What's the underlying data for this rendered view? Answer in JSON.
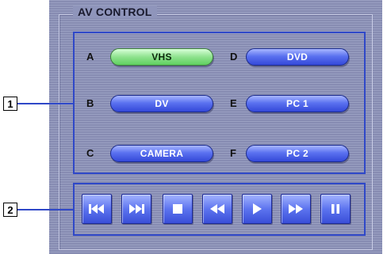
{
  "panel": {
    "title": "AV CONTROL"
  },
  "callouts": {
    "one": "1",
    "two": "2"
  },
  "sources": [
    {
      "letter": "A",
      "label": "VHS",
      "active": true
    },
    {
      "letter": "B",
      "label": "DV",
      "active": false
    },
    {
      "letter": "C",
      "label": "CAMERA",
      "active": false
    },
    {
      "letter": "D",
      "label": "DVD",
      "active": false
    },
    {
      "letter": "E",
      "label": "PC 1",
      "active": false
    },
    {
      "letter": "F",
      "label": "PC 2",
      "active": false
    }
  ],
  "transport": [
    {
      "icon": "skip-previous-icon"
    },
    {
      "icon": "skip-next-icon"
    },
    {
      "icon": "stop-icon"
    },
    {
      "icon": "rewind-icon"
    },
    {
      "icon": "play-icon"
    },
    {
      "icon": "fast-forward-icon"
    },
    {
      "icon": "pause-icon"
    }
  ],
  "colors": {
    "panel": "#8f95bb",
    "highlight_frame": "#2f48c8",
    "button_blue": "#4a60e4",
    "button_active_green": "#8ee28e"
  }
}
